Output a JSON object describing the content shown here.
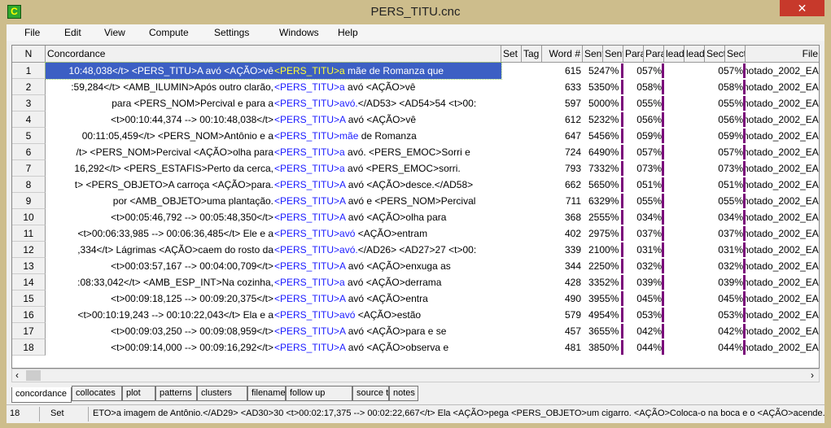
{
  "window": {
    "title": "PERS_TITU.cnc",
    "app_icon_letter": "C",
    "close_glyph": "✕"
  },
  "menu": [
    "File",
    "Edit",
    "View",
    "Compute",
    "Settings",
    "Windows",
    "Help"
  ],
  "columns": [
    "N",
    "Concordance",
    "Set",
    "Tag",
    "Word #",
    "Sent",
    "Sent",
    "Para",
    "Para",
    "Head",
    "Head",
    "Sect",
    "Sect",
    "File"
  ],
  "column_display": [
    "N",
    "Concordance",
    "Set",
    "Tag",
    "Word #",
    "Sent",
    "Sent",
    "Para",
    "Para",
    "lead",
    "lead",
    "Sect",
    "Sect",
    "File"
  ],
  "rows": [
    {
      "n": "1",
      "left": "10:48,038</t> <PERS_TITU>A avó <AÇÃO>vê ",
      "node": "<PERS_TITU>a",
      "right": " mãe de Romanza que",
      "word": "615",
      "sent": "5247%",
      "para": "057%",
      "sect": "057%",
      "file": "notado_2002_EA"
    },
    {
      "n": "2",
      "left": ":59,284</t> <AMB_ILUMIN>Após outro clarão, ",
      "node": "<PERS_TITU>a",
      "right": " avó <AÇÃO>vê",
      "word": "633",
      "sent": "5350%",
      "para": "058%",
      "sect": "058%",
      "file": "notado_2002_EA"
    },
    {
      "n": "3",
      "left": "para <PERS_NOM>Percival e para a ",
      "node": "<PERS_TITU>avó.",
      "right": "</AD53> <AD54>54 <t>00:",
      "word": "597",
      "sent": "5000%",
      "para": "055%",
      "sect": "055%",
      "file": "notado_2002_EA"
    },
    {
      "n": "4",
      "left": "<t>00:10:44,374 --> 00:10:48,038</t> ",
      "node": "<PERS_TITU>A",
      "right": " avó <AÇÃO>vê",
      "word": "612",
      "sent": "5232%",
      "para": "056%",
      "sect": "056%",
      "file": "notado_2002_EA"
    },
    {
      "n": "5",
      "left": "00:11:05,459</t> <PERS_NOM>Antônio e a ",
      "node": "<PERS_TITU>mãe",
      "right": " de Romanza",
      "word": "647",
      "sent": "5456%",
      "para": "059%",
      "sect": "059%",
      "file": "notado_2002_EA"
    },
    {
      "n": "6",
      "left": "/t> <PERS_NOM>Percival <AÇÃO>olha para ",
      "node": "<PERS_TITU>a",
      "right": " avó. <PERS_EMOC>Sorri e",
      "word": "724",
      "sent": "6490%",
      "para": "057%",
      "sect": "057%",
      "file": "notado_2002_EA"
    },
    {
      "n": "7",
      "left": "16,292</t> <PERS_ESTAFIS>Perto da cerca, ",
      "node": "<PERS_TITU>a",
      "right": " avó <PERS_EMOC>sorri.",
      "word": "793",
      "sent": "7332%",
      "para": "073%",
      "sect": "073%",
      "file": "notado_2002_EA"
    },
    {
      "n": "8",
      "left": "t> <PERS_OBJETO>A carroça <AÇÃO>para. ",
      "node": "<PERS_TITU>A",
      "right": " avó <AÇÃO>desce.</AD58>",
      "word": "662",
      "sent": "5650%",
      "para": "051%",
      "sect": "051%",
      "file": "notado_2002_EA"
    },
    {
      "n": "9",
      "left": "por <AMB_OBJETO>uma plantação. ",
      "node": "<PERS_TITU>A",
      "right": " avó e <PERS_NOM>Percival",
      "word": "711",
      "sent": "6329%",
      "para": "055%",
      "sect": "055%",
      "file": "notado_2002_EA"
    },
    {
      "n": "10",
      "left": "<t>00:05:46,792 --> 00:05:48,350</t> ",
      "node": "<PERS_TITU>A",
      "right": " avó <AÇÃO>olha para",
      "word": "368",
      "sent": "2555%",
      "para": "034%",
      "sect": "034%",
      "file": "notado_2002_EA"
    },
    {
      "n": "11",
      "left": "<t>00:06:33,985 --> 00:06:36,485</t> Ele e a ",
      "node": "<PERS_TITU>avó",
      "right": " <AÇÃO>entram",
      "word": "402",
      "sent": "2975%",
      "para": "037%",
      "sect": "037%",
      "file": "notado_2002_EA"
    },
    {
      "n": "12",
      "left": ",334</t> Lágrimas <AÇÃO>caem do rosto da ",
      "node": "<PERS_TITU>avó.",
      "right": "</AD26> <AD27>27 <t>00:",
      "word": "339",
      "sent": "2100%",
      "para": "031%",
      "sect": "031%",
      "file": "notado_2002_EA"
    },
    {
      "n": "13",
      "left": "<t>00:03:57,167 --> 00:04:00,709</t> ",
      "node": "<PERS_TITU>A",
      "right": " avó <AÇÃO>enxuga as",
      "word": "344",
      "sent": "2250%",
      "para": "032%",
      "sect": "032%",
      "file": "notado_2002_EA"
    },
    {
      "n": "14",
      "left": ":08:33,042</t> <AMB_ESP_INT>Na cozinha, ",
      "node": "<PERS_TITU>a",
      "right": " avó <AÇÃO>derrama",
      "word": "428",
      "sent": "3352%",
      "para": "039%",
      "sect": "039%",
      "file": "notado_2002_EA"
    },
    {
      "n": "15",
      "left": "<t>00:09:18,125 --> 00:09:20,375</t> ",
      "node": "<PERS_TITU>A",
      "right": " avó <AÇÃO>entra",
      "word": "490",
      "sent": "3955%",
      "para": "045%",
      "sect": "045%",
      "file": "notado_2002_EA"
    },
    {
      "n": "16",
      "left": "<t>00:10:19,243 --> 00:10:22,043</t> Ela e a ",
      "node": "<PERS_TITU>avó",
      "right": " <AÇÃO>estão",
      "word": "579",
      "sent": "4954%",
      "para": "053%",
      "sect": "053%",
      "file": "notado_2002_EA"
    },
    {
      "n": "17",
      "left": "<t>00:09:03,250 --> 00:09:08,959</t> ",
      "node": "<PERS_TITU>A",
      "right": " avó <AÇÃO>para e se",
      "word": "457",
      "sent": "3655%",
      "para": "042%",
      "sect": "042%",
      "file": "notado_2002_EA"
    },
    {
      "n": "18",
      "left": "<t>00:09:14,000 --> 00:09:16,292</t> ",
      "node": "<PERS_TITU>A",
      "right": " avó <AÇÃO>observa e",
      "word": "481",
      "sent": "3850%",
      "para": "044%",
      "sect": "044%",
      "file": "notado_2002_EA"
    }
  ],
  "selected_row": 1,
  "tabs": [
    "concordance",
    "collocates",
    "plot",
    "patterns",
    "clusters",
    "filenames",
    "follow up",
    "source text",
    "notes"
  ],
  "active_tab": "concordance",
  "status": {
    "row": "18",
    "column": "Set",
    "text": "ETO>a imagem de Antônio.</AD29> <AD30>30 <t>00:02:17,375 --> 00:02:22,667</t> Ela <AÇÃO>pega <PERS_OBJETO>um cigarro. <AÇÃO>Coloca-o na boca e o <AÇÃO>acende.</AD30"
  },
  "colors": {
    "node": "#1a1aff",
    "selection": "#3c5fc4",
    "selected_node": "#ffff33",
    "plot_bar": "#7a0a7a",
    "close": "#c7392b"
  },
  "scroll": {
    "left_glyph": "‹",
    "right_glyph": "›"
  }
}
